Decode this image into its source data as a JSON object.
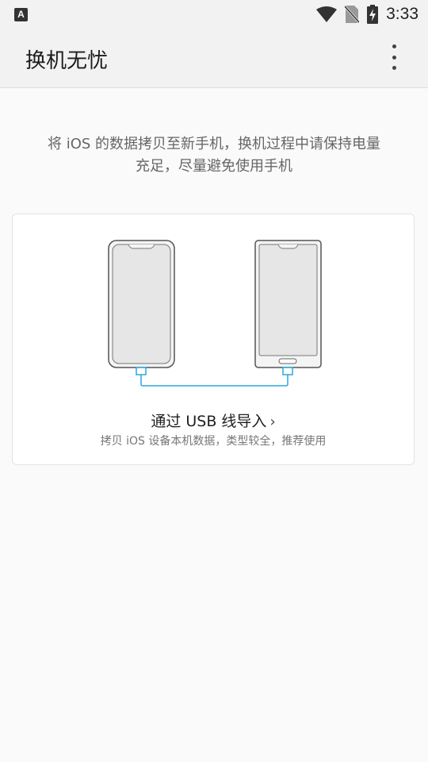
{
  "status_bar": {
    "time": "3:33",
    "icons": [
      "a-notification-icon",
      "wifi-icon",
      "no-sim-icon",
      "battery-charging-icon"
    ]
  },
  "app_bar": {
    "title": "换机无忧",
    "menu_icon": "more-vertical-icon"
  },
  "description": {
    "line1": "将 iOS 的数据拷贝至新手机，换机过程中请保持电量",
    "line2": "充足，尽量避免使用手机"
  },
  "usb_option": {
    "title": "通过 USB 线导入",
    "chevron": "›",
    "subtitle": "拷贝 iOS 设备本机数据，类型较全，推荐使用",
    "illustration": "two-phones-usb-cable",
    "accent_color": "#29a9e0"
  }
}
